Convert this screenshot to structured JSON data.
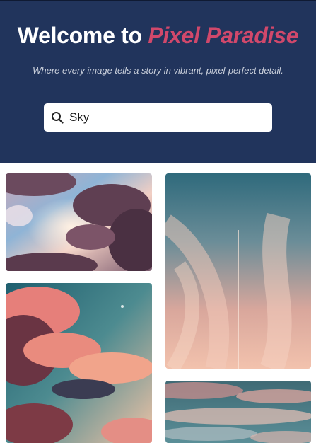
{
  "header": {
    "title_prefix": "Welcome to",
    "title_brand": "Pixel Paradise",
    "subtitle": "Where every image tells a story in vibrant, pixel-perfect detail."
  },
  "search": {
    "icon": "search-icon",
    "value": "Sky"
  },
  "gallery": {
    "images": [
      {
        "name": "sky-clouds-pastel"
      },
      {
        "name": "sky-wispy-contrail"
      },
      {
        "name": "sky-sunset-clouds"
      },
      {
        "name": "sky-clouds-teal"
      }
    ]
  },
  "colors": {
    "header_bg": "#21345c",
    "brand_accent": "#d1486b",
    "title_text": "#ffffff",
    "subtitle_text": "#c9cfdb"
  }
}
